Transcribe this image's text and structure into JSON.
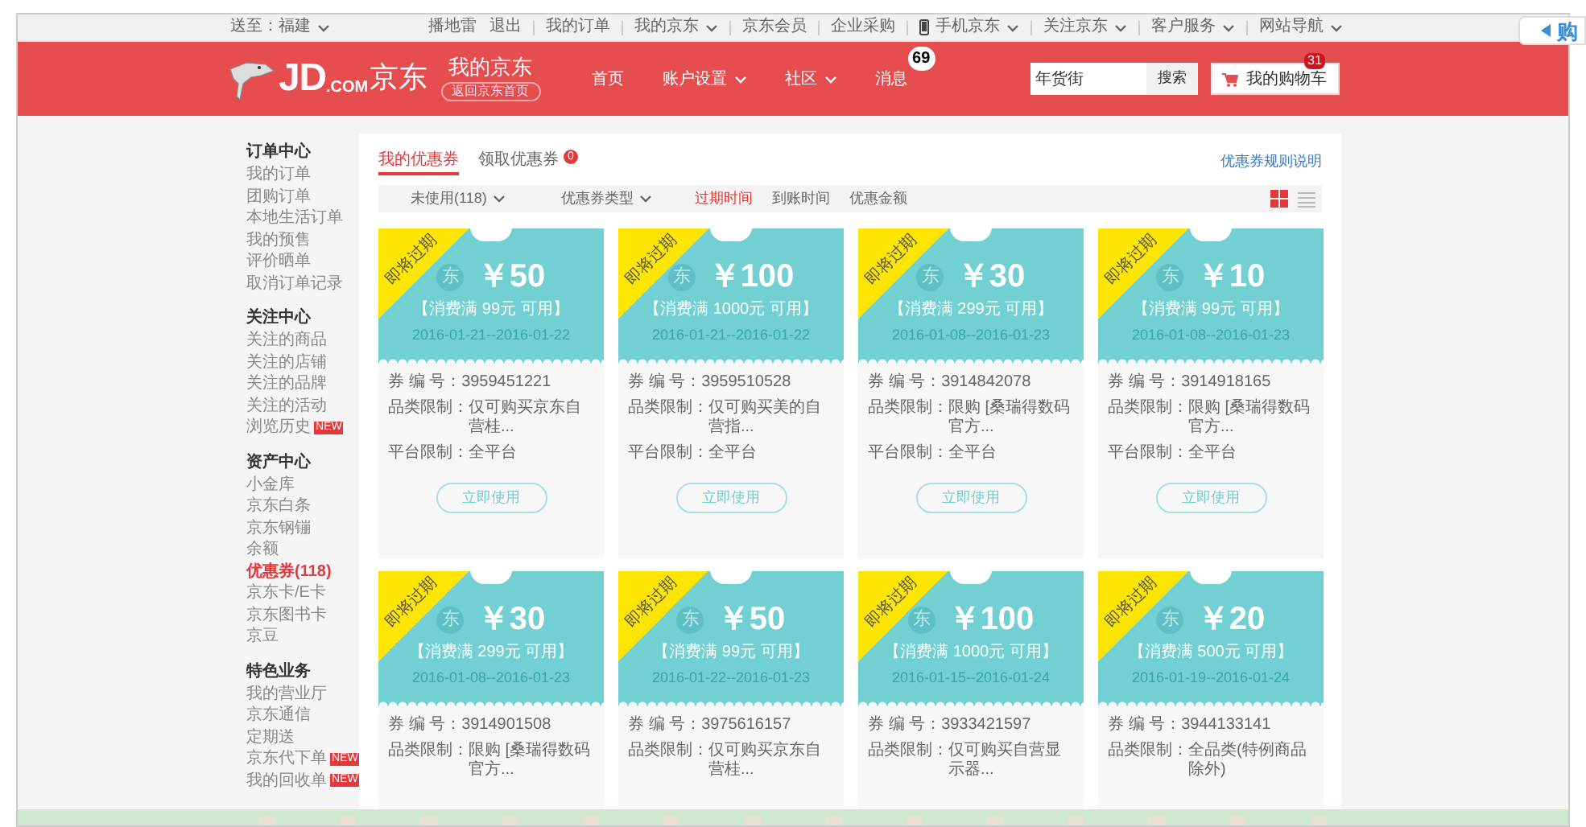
{
  "topbar": {
    "location": "送至：福建",
    "links": [
      {
        "label": "播地雷",
        "dropdown": false
      },
      {
        "label": "退出",
        "dropdown": false
      },
      {
        "label": "我的订单",
        "dropdown": false
      },
      {
        "label": "我的京东",
        "dropdown": true
      },
      {
        "label": "京东会员",
        "dropdown": false
      },
      {
        "label": "企业采购",
        "dropdown": false
      },
      {
        "label": "手机京东",
        "dropdown": true
      },
      {
        "label": "关注京东",
        "dropdown": true
      },
      {
        "label": "客户服务",
        "dropdown": true
      },
      {
        "label": "网站导航",
        "dropdown": true
      }
    ]
  },
  "side_tab": {
    "label": "购"
  },
  "header": {
    "logo_jd": "JD",
    "logo_com": ".COM",
    "logo_cn": "京东",
    "title": "我的京东",
    "back_link": "返回京东首页",
    "nav": [
      {
        "label": "首页",
        "dropdown": false
      },
      {
        "label": "账户设置",
        "dropdown": true
      },
      {
        "label": "社区",
        "dropdown": true
      },
      {
        "label": "消息",
        "dropdown": false,
        "badge": "69"
      }
    ],
    "search": {
      "value": "年货街",
      "button": "搜索"
    },
    "cart": {
      "label": "我的购物车",
      "badge": "31"
    }
  },
  "sidebar": [
    {
      "title": "订单中心",
      "items": [
        {
          "label": "我的订单",
          "selected": false
        },
        {
          "label": "团购订单",
          "selected": false
        },
        {
          "label": "本地生活订单",
          "selected": false
        },
        {
          "label": "我的预售",
          "selected": false
        },
        {
          "label": "评价晒单",
          "selected": false
        },
        {
          "label": "取消订单记录",
          "selected": false
        }
      ]
    },
    {
      "title": "关注中心",
      "items": [
        {
          "label": "关注的商品",
          "selected": false
        },
        {
          "label": "关注的店铺",
          "selected": false
        },
        {
          "label": "关注的品牌",
          "selected": false
        },
        {
          "label": "关注的活动",
          "selected": false
        },
        {
          "label": "浏览历史",
          "selected": false,
          "badge": "NEW"
        }
      ]
    },
    {
      "title": "资产中心",
      "items": [
        {
          "label": "小金库",
          "selected": false
        },
        {
          "label": "京东白条",
          "selected": false
        },
        {
          "label": "京东钢镚",
          "selected": false
        },
        {
          "label": "余额",
          "selected": false
        },
        {
          "label": "优惠券(118)",
          "selected": true
        },
        {
          "label": "京东卡/E卡",
          "selected": false
        },
        {
          "label": "京东图书卡",
          "selected": false
        },
        {
          "label": "京豆",
          "selected": false
        }
      ]
    },
    {
      "title": "特色业务",
      "items": [
        {
          "label": "我的营业厅",
          "selected": false
        },
        {
          "label": "京东通信",
          "selected": false
        },
        {
          "label": "定期送",
          "selected": false
        },
        {
          "label": "京东代下单",
          "selected": false,
          "badge": "NEW"
        },
        {
          "label": "我的回收单",
          "selected": false,
          "badge": "NEW"
        }
      ]
    }
  ],
  "tabs": [
    {
      "label": "我的优惠券",
      "selected": true
    },
    {
      "label": "领取优惠券",
      "selected": false,
      "badge": "0"
    }
  ],
  "rules_link": "优惠券规则说明",
  "filters": {
    "dropdowns": [
      "未使用(118)",
      "优惠券类型"
    ],
    "sorts": [
      {
        "label": "过期时间",
        "selected": true
      },
      {
        "label": "到账时间",
        "selected": false
      },
      {
        "label": "优惠金额",
        "selected": false
      }
    ],
    "views": [
      {
        "kind": "grid",
        "selected": true
      },
      {
        "kind": "list",
        "selected": false
      }
    ]
  },
  "coupons": [
    {
      "ribbon": "即将过期",
      "logo": "东",
      "amount": "￥50",
      "condition": "【消费满 99元 可用】",
      "dates": "2016-01-21--2016-01-22",
      "fields": [
        {
          "label": "券 编 号：",
          "value": "3959451221"
        },
        {
          "label": "品类限制：",
          "value": "仅可购买京东自营桂..."
        },
        {
          "label": "平台限制：",
          "value": "全平台"
        }
      ],
      "button": "立即使用"
    },
    {
      "ribbon": "即将过期",
      "logo": "东",
      "amount": "￥100",
      "condition": "【消费满 1000元 可用】",
      "dates": "2016-01-21--2016-01-22",
      "fields": [
        {
          "label": "券 编 号：",
          "value": "3959510528"
        },
        {
          "label": "品类限制：",
          "value": "仅可购买美的自营指..."
        },
        {
          "label": "平台限制：",
          "value": "全平台"
        }
      ],
      "button": "立即使用"
    },
    {
      "ribbon": "即将过期",
      "logo": "东",
      "amount": "￥30",
      "condition": "【消费满 299元 可用】",
      "dates": "2016-01-08--2016-01-23",
      "fields": [
        {
          "label": "券 编 号：",
          "value": "3914842078"
        },
        {
          "label": "品类限制：",
          "value": "限购 [桑瑞得数码官方..."
        },
        {
          "label": "平台限制：",
          "value": "全平台"
        }
      ],
      "button": "立即使用"
    },
    {
      "ribbon": "即将过期",
      "logo": "东",
      "amount": "￥10",
      "condition": "【消费满 99元 可用】",
      "dates": "2016-01-08--2016-01-23",
      "fields": [
        {
          "label": "券 编 号：",
          "value": "3914918165"
        },
        {
          "label": "品类限制：",
          "value": "限购 [桑瑞得数码官方..."
        },
        {
          "label": "平台限制：",
          "value": "全平台"
        }
      ],
      "button": "立即使用"
    },
    {
      "ribbon": "即将过期",
      "logo": "东",
      "amount": "￥30",
      "condition": "【消费满 299元 可用】",
      "dates": "2016-01-08--2016-01-23",
      "fields": [
        {
          "label": "券 编 号：",
          "value": "3914901508"
        },
        {
          "label": "品类限制：",
          "value": "限购 [桑瑞得数码官方..."
        }
      ]
    },
    {
      "ribbon": "即将过期",
      "logo": "东",
      "amount": "￥50",
      "condition": "【消费满 99元 可用】",
      "dates": "2016-01-22--2016-01-23",
      "fields": [
        {
          "label": "券 编 号：",
          "value": "3975616157"
        },
        {
          "label": "品类限制：",
          "value": "仅可购买京东自营桂..."
        }
      ]
    },
    {
      "ribbon": "即将过期",
      "logo": "东",
      "amount": "￥100",
      "condition": "【消费满 1000元 可用】",
      "dates": "2016-01-15--2016-01-24",
      "fields": [
        {
          "label": "券 编 号：",
          "value": "3933421597"
        },
        {
          "label": "品类限制：",
          "value": "仅可购买自营显示器..."
        }
      ]
    },
    {
      "ribbon": "即将过期",
      "logo": "东",
      "amount": "￥20",
      "condition": "【消费满 500元 可用】",
      "dates": "2016-01-19--2016-01-24",
      "fields": [
        {
          "label": "券 编 号：",
          "value": "3944133141"
        },
        {
          "label": "品类限制：",
          "value": "全品类(特例商品除外)"
        }
      ]
    }
  ]
}
